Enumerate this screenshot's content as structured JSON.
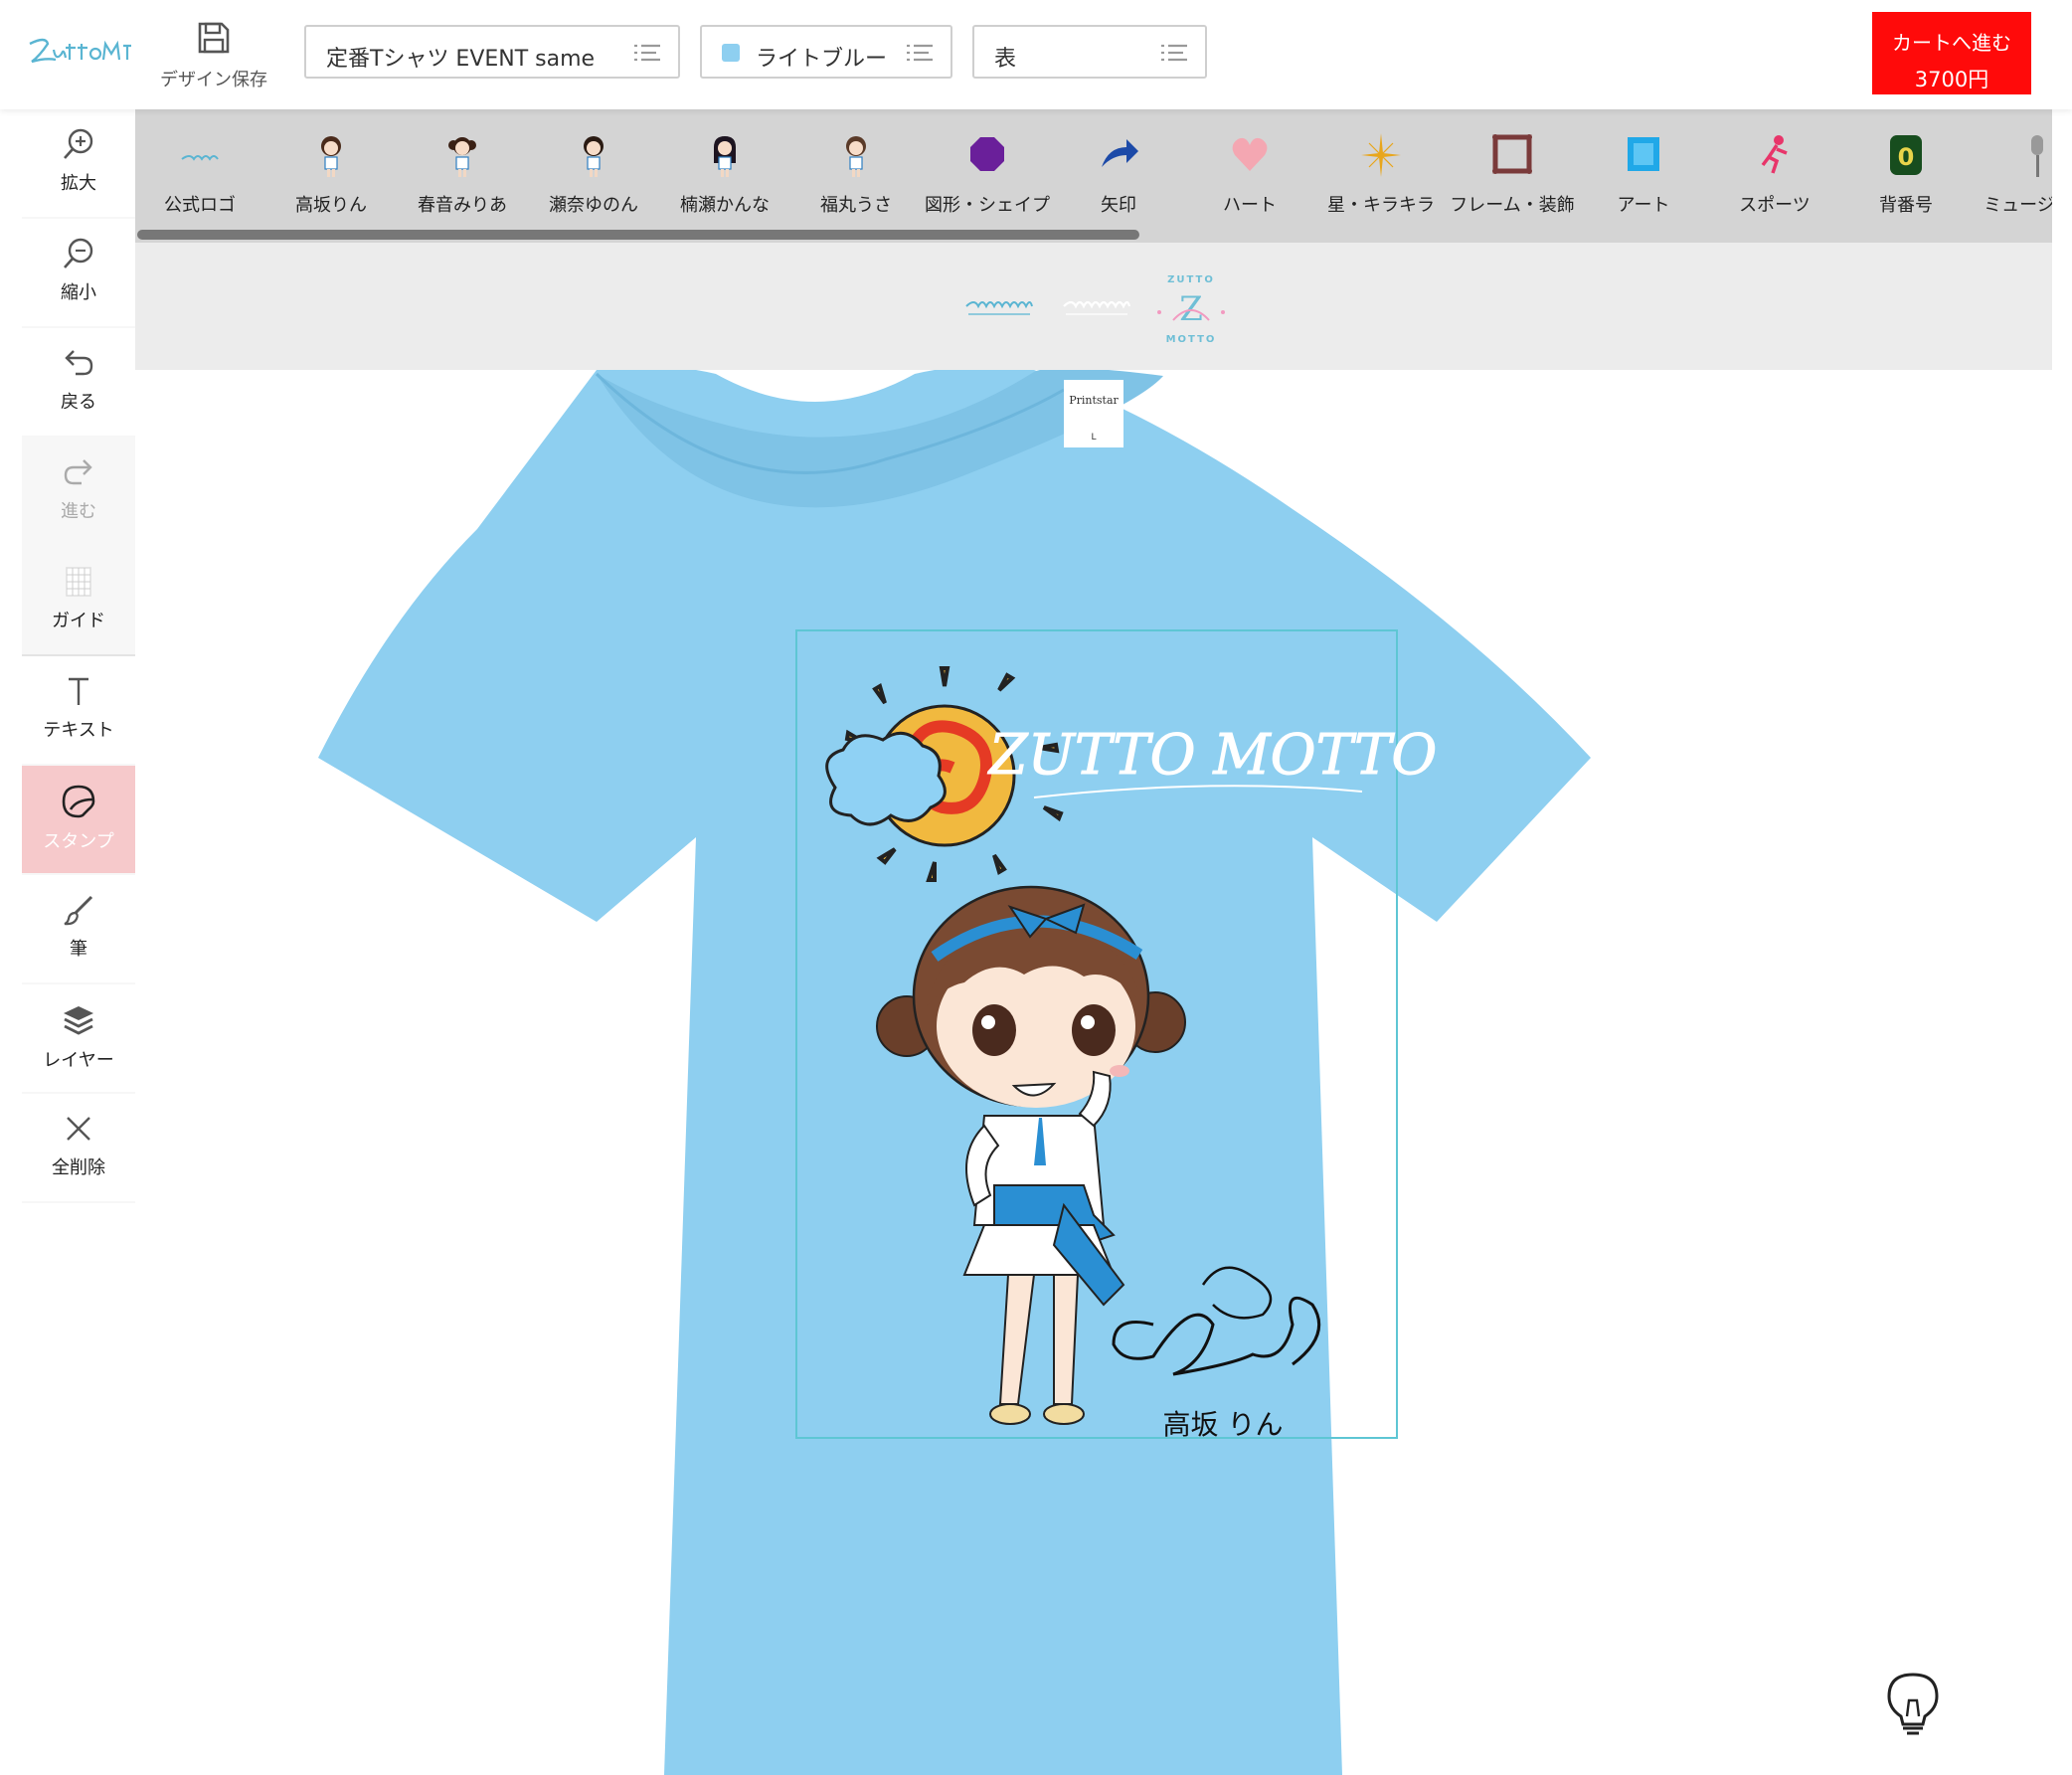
{
  "header": {
    "logo_icon": "zutto-motto-logo",
    "save_label": "デザイン保存",
    "product_select": {
      "value": "定番Tシャツ EVENT same"
    },
    "color_select": {
      "value": "ライトブルー",
      "swatch": "#8ecff0"
    },
    "side_select": {
      "value": "表"
    },
    "cart": {
      "label": "カートへ進む",
      "price": "3700円",
      "color": "#ff0a0a"
    }
  },
  "tools": [
    {
      "key": "zoom-in",
      "label": "拡大"
    },
    {
      "key": "zoom-out",
      "label": "縮小"
    },
    {
      "key": "undo",
      "label": "戻る"
    },
    {
      "key": "redo",
      "label": "進む"
    },
    {
      "key": "guide",
      "label": "ガイド"
    },
    {
      "key": "text",
      "label": "テキスト"
    },
    {
      "key": "stamp",
      "label": "スタンプ"
    },
    {
      "key": "brush",
      "label": "筆"
    },
    {
      "key": "layer",
      "label": "レイヤー"
    },
    {
      "key": "delete-all",
      "label": "全削除"
    }
  ],
  "stamp_categories": [
    {
      "label": "公式ロゴ"
    },
    {
      "label": "高坂りん"
    },
    {
      "label": "春音みりあ"
    },
    {
      "label": "瀬奈ゆのん"
    },
    {
      "label": "楠瀬かんな"
    },
    {
      "label": "福丸うさ"
    },
    {
      "label": "図形・シェイプ"
    },
    {
      "label": "矢印"
    },
    {
      "label": "ハート"
    },
    {
      "label": "星・キラキラ"
    },
    {
      "label": "フレーム・装飾"
    },
    {
      "label": "アート"
    },
    {
      "label": "スポーツ"
    },
    {
      "label": "背番号",
      "number": "0"
    },
    {
      "label": "ミュージック"
    }
  ],
  "canvas": {
    "shirt_color": "#8ecff0",
    "print_area_color": "#5ec6d4",
    "logo_text": "ZUTTO MOTTO",
    "signature_text": "高坂 りん",
    "tag_text": "Printstar",
    "tag_size": "L"
  },
  "logo_strip": {
    "badge_letter": "Z",
    "badge_top": "ZUTTO",
    "badge_bottom": "MOTTO"
  }
}
